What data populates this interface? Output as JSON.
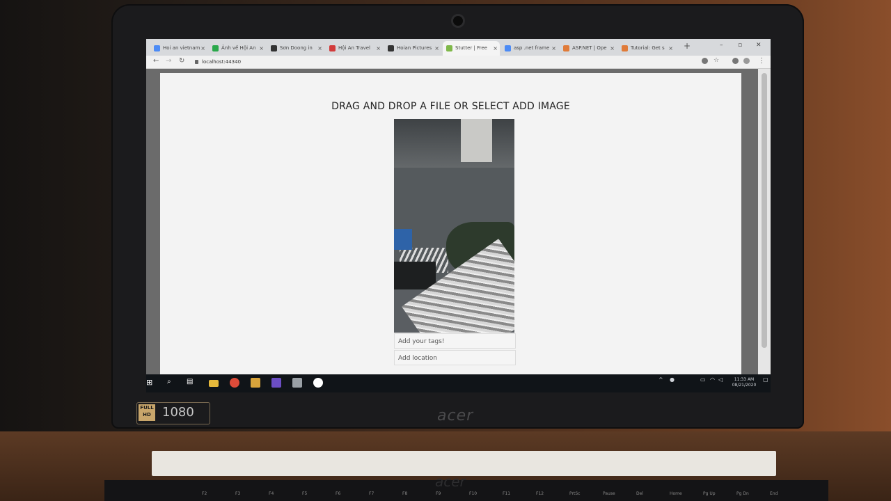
{
  "browser": {
    "tabs": [
      {
        "label": "Hoi an vietnam",
        "active": false,
        "favicon_color": "#4c8bf5"
      },
      {
        "label": "Ảnh về Hội An",
        "active": false,
        "favicon_color": "#2aa84a"
      },
      {
        "label": "Sơn Doong in",
        "active": false,
        "favicon_color": "#333333"
      },
      {
        "label": "Hội An Travel",
        "active": false,
        "favicon_color": "#d23b3b"
      },
      {
        "label": "Hoian Pictures",
        "active": false,
        "favicon_color": "#333333"
      },
      {
        "label": "Stutter | Free",
        "active": true,
        "favicon_color": "#7fb84a"
      },
      {
        "label": "asp .net frame",
        "active": false,
        "favicon_color": "#4c8bf5"
      },
      {
        "label": "ASP.NET | Ope",
        "active": false,
        "favicon_color": "#e07b39"
      },
      {
        "label": "Tutorial: Get s",
        "active": false,
        "favicon_color": "#e07b39"
      }
    ],
    "new_tab": "+",
    "url": "localhost:44340"
  },
  "modal": {
    "title": "DRAG AND DROP A FILE OR SELECT ADD IMAGE",
    "tags_placeholder": "Add your tags!",
    "location_placeholder": "Add location"
  },
  "taskbar": {
    "time": "11:33 AM",
    "date": "08/21/2020"
  },
  "bezel": {
    "hd_label": "FULL HD",
    "resolution": "1080",
    "brand": "acer"
  },
  "keys": [
    "F2",
    "F3",
    "F4",
    "F5",
    "F6",
    "F7",
    "F8",
    "F9",
    "F10",
    "F11",
    "F12",
    "PrtSc",
    "Pause",
    "Del",
    "Home",
    "Pg Up",
    "Pg Dn",
    "End"
  ]
}
